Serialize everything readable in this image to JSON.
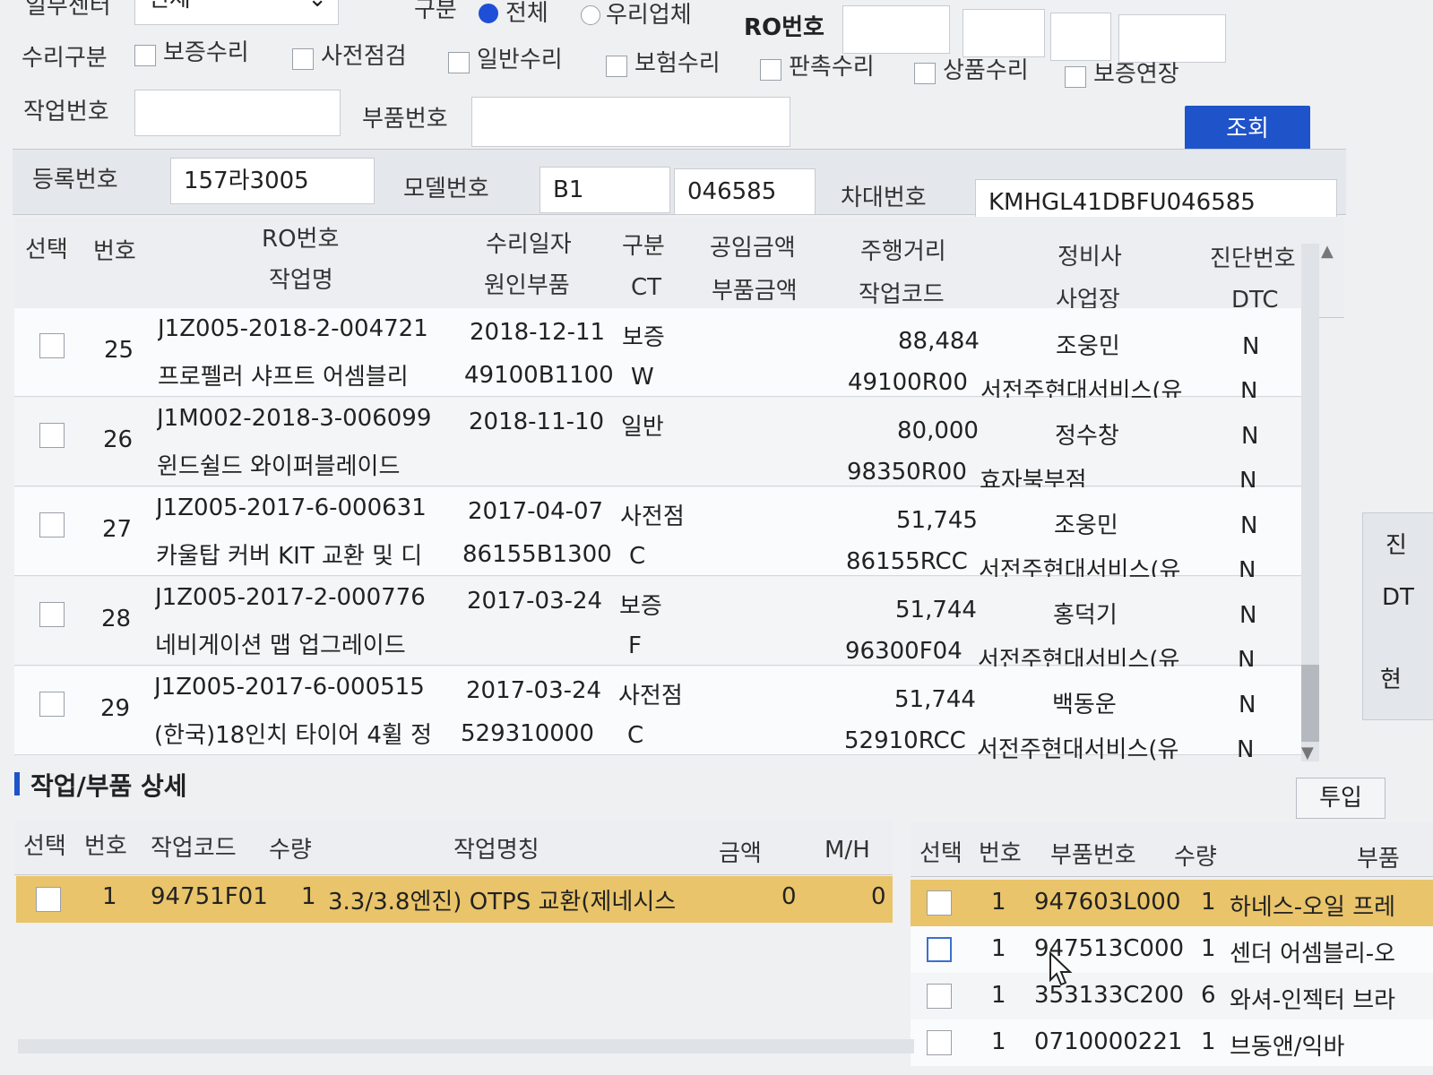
{
  "filters": {
    "top_label": "일부센터",
    "top_select_value": "전체",
    "gubun_label": "구분",
    "gubun_options": [
      "전체",
      "우리업체"
    ],
    "ro_label": "RO번호",
    "repair_type_label": "수리구분",
    "repair_types": [
      "보증수리",
      "사전점검",
      "일반수리",
      "보험수리",
      "판촉수리",
      "상품수리",
      "보증연장"
    ],
    "work_no_label": "작업번호",
    "part_no_label": "부품번호",
    "search_button": "조회"
  },
  "vehicle": {
    "reg_label": "등록번호",
    "reg_value": "157라3005",
    "model_label": "모델번호",
    "model_value1": "B1",
    "model_value2": "046585",
    "vin_label": "차대번호",
    "vin_value": "KMHGL41DBFU046585"
  },
  "history_table": {
    "headers_top": [
      "선택",
      "번호",
      "RO번호",
      "수리일자",
      "구분",
      "공임금액",
      "주행거리",
      "정비사",
      "진단번호"
    ],
    "headers_bottom": [
      "작업명",
      "원인부품",
      "CT",
      "부품금액",
      "작업코드",
      "사업장",
      "DTC"
    ],
    "rows": [
      {
        "no": "25",
        "ro": "J1Z005-2018-2-004721",
        "date": "2018-12-11",
        "gubun": "보증",
        "mileage": "88,484",
        "mechanic": "조웅민",
        "diag": "N",
        "work": "프로펠러 샤프트 어셈블리",
        "cause": "49100B1100",
        "ct": "W",
        "code": "49100R00",
        "shop": "서전주현대서비스(유",
        "dtc": "N"
      },
      {
        "no": "26",
        "ro": "J1M002-2018-3-006099",
        "date": "2018-11-10",
        "gubun": "일반",
        "mileage": "80,000",
        "mechanic": "정수창",
        "diag": "N",
        "work": "윈드쉴드 와이퍼블레이드",
        "cause": "",
        "ct": "",
        "code": "98350R00",
        "shop": "효자북부점",
        "dtc": "N"
      },
      {
        "no": "27",
        "ro": "J1Z005-2017-6-000631",
        "date": "2017-04-07",
        "gubun": "사전점",
        "mileage": "51,745",
        "mechanic": "조웅민",
        "diag": "N",
        "work": "카울탑 커버 KIT 교환 및 디",
        "cause": "86155B1300",
        "ct": "C",
        "code": "86155RCC",
        "shop": "서전주현대서비스(유",
        "dtc": "N"
      },
      {
        "no": "28",
        "ro": "J1Z005-2017-2-000776",
        "date": "2017-03-24",
        "gubun": "보증",
        "mileage": "51,744",
        "mechanic": "홍덕기",
        "diag": "N",
        "work": "네비게이션 맵 업그레이드",
        "cause": "",
        "ct": "F",
        "code": "96300F04",
        "shop": "서전주현대서비스(유",
        "dtc": "N"
      },
      {
        "no": "29",
        "ro": "J1Z005-2017-6-000515",
        "date": "2017-03-24",
        "gubun": "사전점",
        "mileage": "51,744",
        "mechanic": "백동운",
        "diag": "N",
        "work": "(한국)18인치 타이어 4휠 정",
        "cause": "529310000",
        "ct": "C",
        "code": "52910RCC",
        "shop": "서전주현대서비스(유",
        "dtc": "N"
      }
    ]
  },
  "detail": {
    "title": "작업/부품 상세",
    "input_button": "투입",
    "work_headers": [
      "선택",
      "번호",
      "작업코드",
      "수량",
      "작업명칭",
      "금액",
      "M/H"
    ],
    "work_rows": [
      {
        "no": "1",
        "code": "94751F01",
        "qty": "1",
        "name": "3.3/3.8엔진) OTPS 교환(제네시스",
        "amount": "0",
        "mh": "0"
      }
    ],
    "part_headers": [
      "선택",
      "번호",
      "부품번호",
      "수량",
      "부품"
    ],
    "part_rows": [
      {
        "no": "1",
        "part": "947603L000",
        "qty": "1",
        "name": "하네스-오일 프레"
      },
      {
        "no": "1",
        "part": "947513C000",
        "qty": "1",
        "name": "센더 어셈블리-오"
      },
      {
        "no": "1",
        "part": "353133C200",
        "qty": "6",
        "name": "와셔-인젝터 브라"
      },
      {
        "no": "1",
        "part": "0710000221",
        "qty": "1",
        "name": "브동앤/익바"
      }
    ]
  },
  "side_tabs": [
    "진",
    "DT",
    "현"
  ],
  "colors": {
    "accent_blue": "#1f53c9",
    "row_highlight": "#e9c46a"
  }
}
